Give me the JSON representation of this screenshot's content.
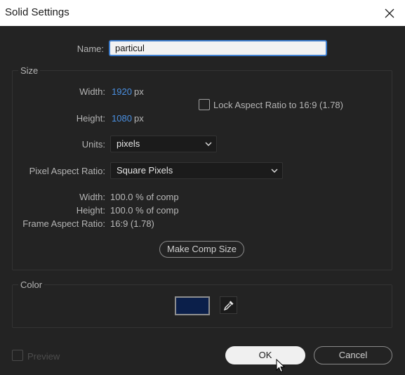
{
  "window": {
    "title": "Solid Settings"
  },
  "name_field": {
    "label": "Name:",
    "value": "particul"
  },
  "size": {
    "title": "Size",
    "width_label": "Width:",
    "width_value": "1920",
    "width_unit": "px",
    "height_label": "Height:",
    "height_value": "1080",
    "height_unit": "px",
    "lock_aspect_label": "Lock Aspect Ratio to 16:9 (1.78)",
    "lock_aspect_checked": false,
    "units_label": "Units:",
    "units_value": "pixels",
    "par_label": "Pixel Aspect Ratio:",
    "par_value": "Square Pixels",
    "comp_width_label": "Width:",
    "comp_width_value": "100.0 % of comp",
    "comp_height_label": "Height:",
    "comp_height_value": "100.0 % of comp",
    "frame_aspect_label": "Frame Aspect Ratio:",
    "frame_aspect_value": "16:9 (1.78)",
    "make_comp_size": "Make Comp Size"
  },
  "color": {
    "title": "Color",
    "swatch": "#0b1f4a"
  },
  "footer": {
    "preview_label": "Preview",
    "preview_checked": false,
    "ok_label": "OK",
    "cancel_label": "Cancel"
  },
  "icons": {
    "close": "close-icon",
    "chevron": "chevron-down-icon",
    "eyedropper": "eyedropper-icon",
    "cursor": "mouse-cursor-icon"
  }
}
